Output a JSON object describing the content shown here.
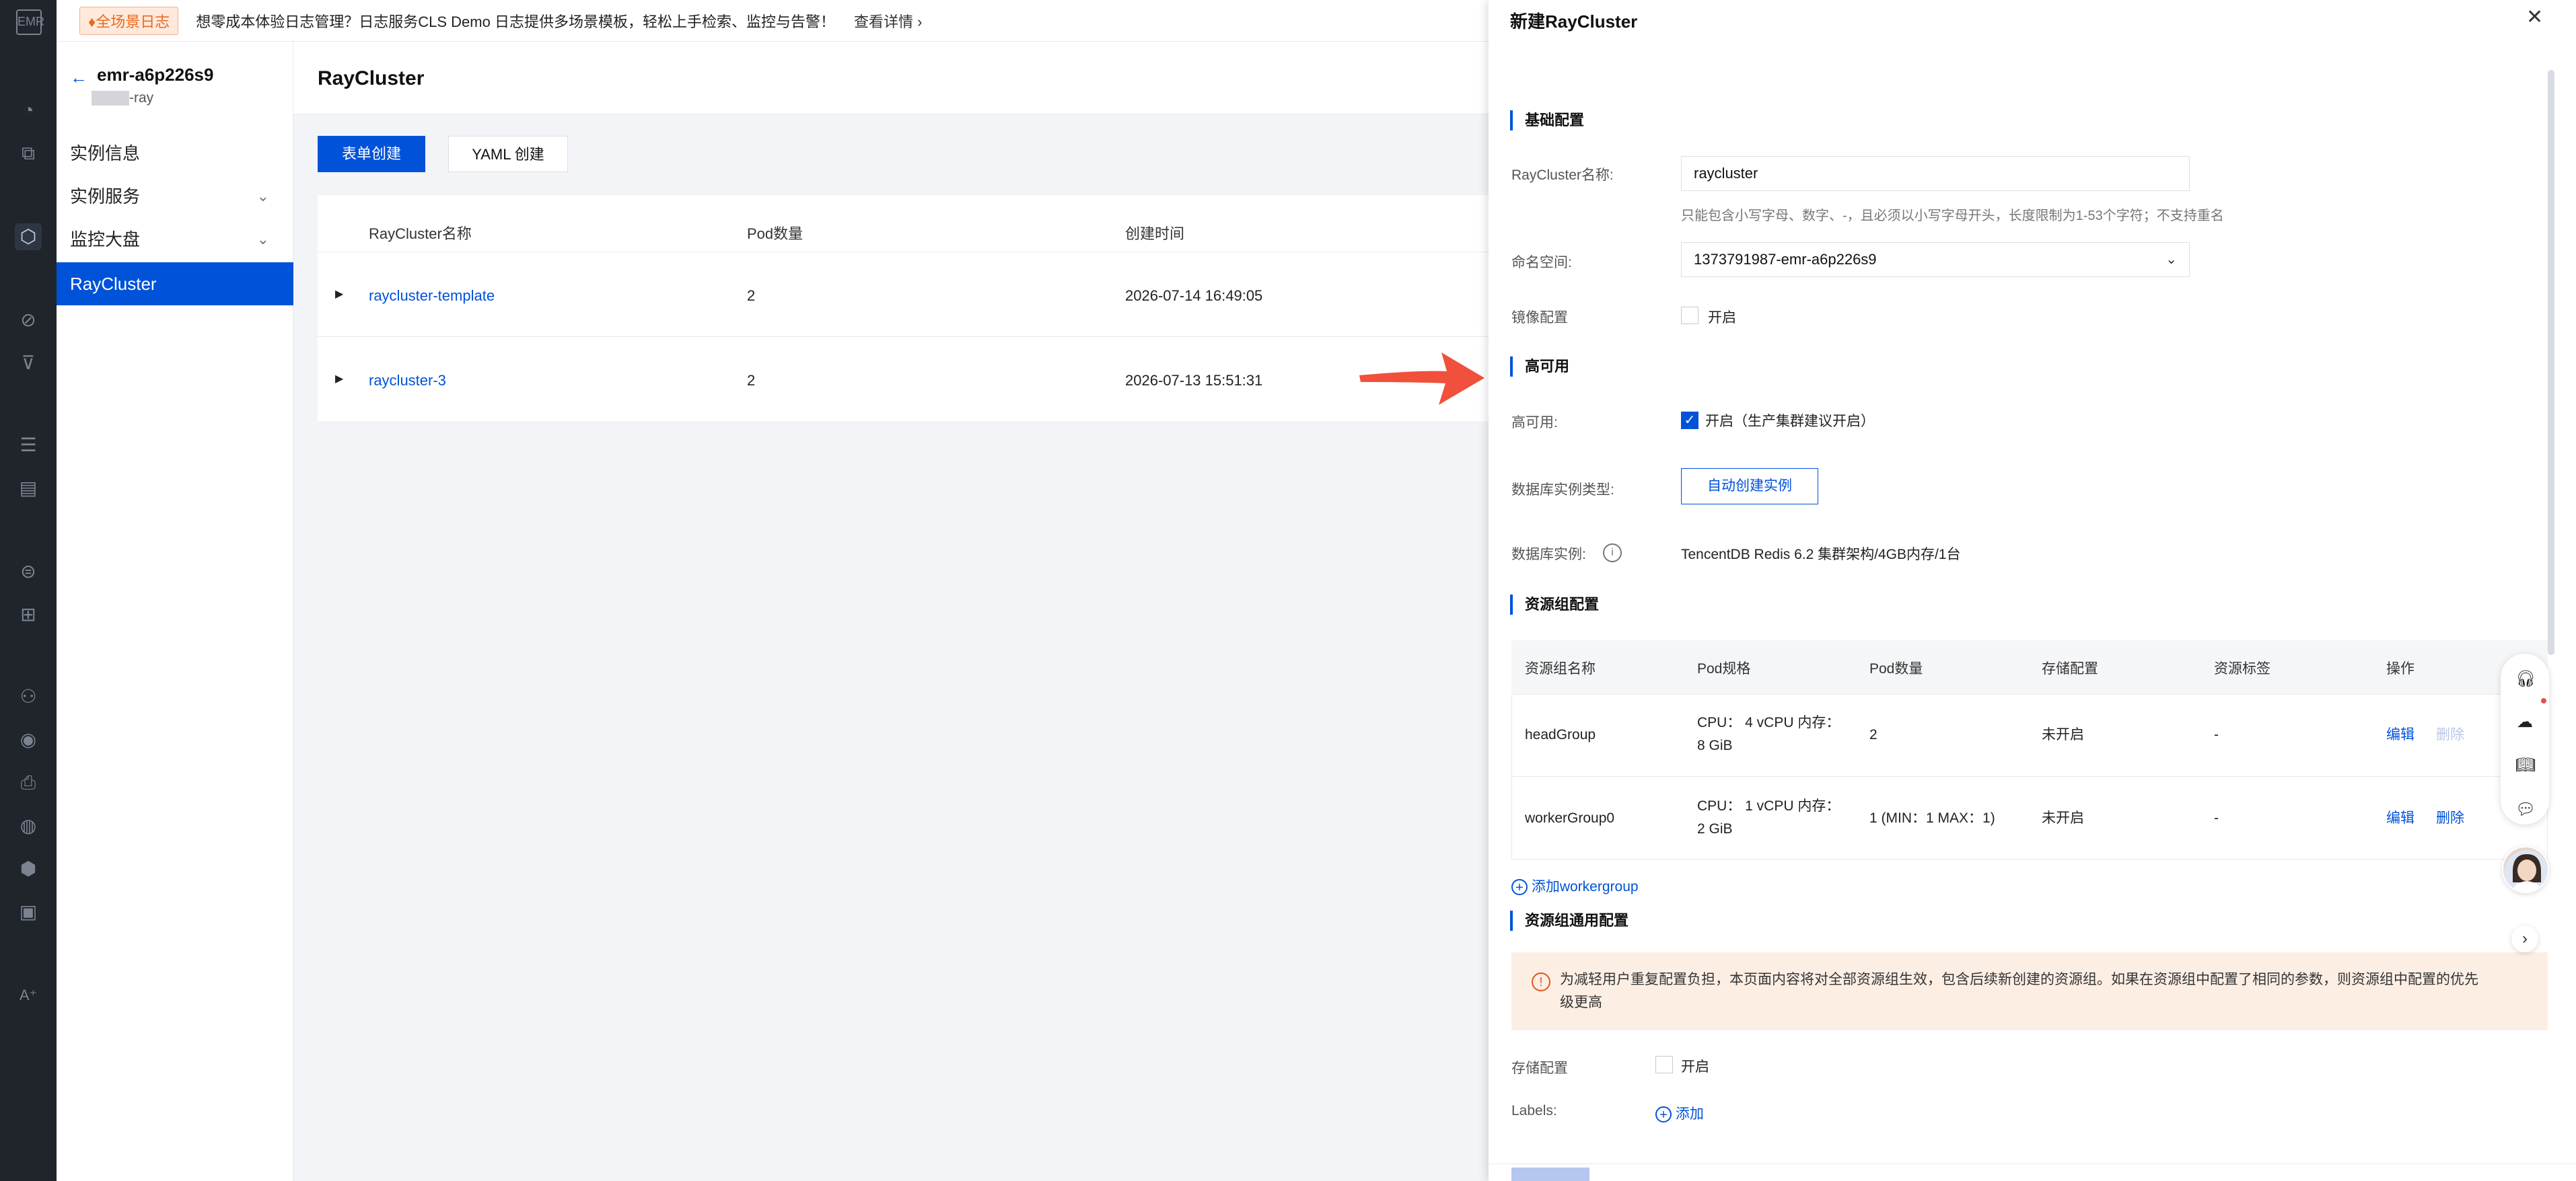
{
  "banner": {
    "tag": "♦全场景日志",
    "text": "想零成本体验日志管理？日志服务CLS Demo 日志提供多场景模板，轻松上手检索、监控与告警！",
    "link": "查看详情 ›"
  },
  "sidebar": {
    "back_icon": "arrow-left-icon",
    "title": "emr-a6p226s9",
    "subtitle": "-ray",
    "items": [
      {
        "label": "实例信息",
        "expandable": false
      },
      {
        "label": "实例服务",
        "expandable": true
      },
      {
        "label": "监控大盘",
        "expandable": true
      },
      {
        "label": "RayCluster",
        "expandable": false,
        "active": true
      }
    ]
  },
  "main": {
    "title": "RayCluster",
    "form_create_label": "表单创建",
    "yaml_create_label": "YAML 创建",
    "table": {
      "columns": [
        "RayCluster名称",
        "Pod数量",
        "创建时间"
      ],
      "rows": [
        {
          "name": "raycluster-template",
          "pods": "2",
          "created": "2026-07-14 16:49:05"
        },
        {
          "name": "raycluster-3",
          "pods": "2",
          "created": "2026-07-13 15:51:31"
        }
      ]
    }
  },
  "drawer": {
    "title": "新建RayCluster",
    "close_icon": "close-icon",
    "sections": {
      "basic": "基础配置",
      "ha": "高可用",
      "resource_group": "资源组配置",
      "resource_group_common": "资源组通用配置"
    },
    "fields": {
      "name_label": "RayCluster名称:",
      "name_value": "raycluster",
      "name_hint": "只能包含小写字母、数字、-，且必须以小写字母开头，长度限制为1-53个字符；不支持重名",
      "namespace_label": "命名空间:",
      "namespace_value": "1373791987-emr-a6p226s9",
      "mirror_label": "镜像配置",
      "mirror_option": "开启",
      "mirror_checked": false,
      "ha_label": "高可用:",
      "ha_option": "开启（生产集群建议开启）",
      "ha_checked": true,
      "db_type_label": "数据库实例类型:",
      "db_type_button": "自动创建实例",
      "db_instance_label": "数据库实例:",
      "db_instance_value": "TencentDB Redis 6.2 集群架构/4GB内存/1台"
    },
    "resource_table": {
      "columns": [
        "资源组名称",
        "Pod规格",
        "Pod数量",
        "存储配置",
        "资源标签",
        "操作"
      ],
      "rows": [
        {
          "name": "headGroup",
          "spec_line1": "CPU： 4 vCPU 内存：",
          "spec_line2": "8 GiB",
          "pods": "2",
          "storage": "未开启",
          "labels": "-",
          "edit": "编辑",
          "delete": "删除",
          "delete_enabled": false
        },
        {
          "name": "workerGroup0",
          "spec_line1": "CPU： 1 vCPU 内存：",
          "spec_line2": "2 GiB",
          "pods": "1 (MIN：1 MAX：1)",
          "storage": "未开启",
          "labels": "-",
          "edit": "编辑",
          "delete": "删除",
          "delete_enabled": true
        }
      ],
      "add_label": "添加workergroup"
    },
    "alert": {
      "line1": "为减轻用户重复配置负担，本页面内容将对全部资源组生效，包含后续新创建的资源组。如果在资源组中配置了相同的参数，则资源组中配置的优先",
      "line2": "级更高"
    },
    "common": {
      "storage_label": "存储配置",
      "storage_option": "开启",
      "storage_checked": false,
      "labels_label": "Labels:",
      "labels_add": "添加"
    }
  },
  "float_tools": [
    "headset-icon",
    "cloud-icon",
    "book-icon",
    "chat-icon"
  ],
  "colors": {
    "primary": "#0052d9",
    "arrow": "#f0503c",
    "alert_bg": "#fdeee4"
  }
}
